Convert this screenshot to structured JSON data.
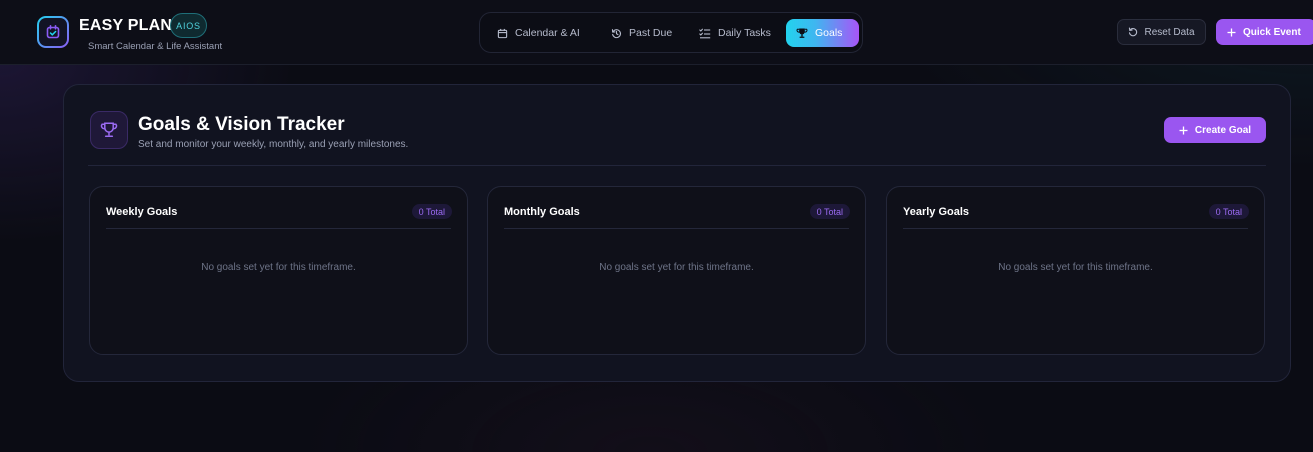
{
  "header": {
    "title": "EASY PLAN",
    "badge": "AIOS",
    "subtitle": "Smart Calendar & Life Assistant",
    "logo_icon": "calendar-check-icon"
  },
  "nav": {
    "tabs": [
      {
        "label": "Calendar & AI",
        "icon": "calendar-icon",
        "active": false
      },
      {
        "label": "Past Due",
        "icon": "history-icon",
        "active": false
      },
      {
        "label": "Daily Tasks",
        "icon": "list-checks-icon",
        "active": false
      },
      {
        "label": "Goals",
        "icon": "trophy-icon",
        "active": true
      }
    ]
  },
  "actions": {
    "reset_label": "Reset Data",
    "quick_event_label": "Quick Event"
  },
  "goals": {
    "title": "Goals & Vision Tracker",
    "subtitle": "Set and monitor your weekly, monthly, and yearly milestones.",
    "create_label": "Create Goal",
    "columns": [
      {
        "title": "Weekly Goals",
        "count": "0 Total",
        "empty_text": "No goals set yet for this timeframe."
      },
      {
        "title": "Monthly Goals",
        "count": "0 Total",
        "empty_text": "No goals set yet for this timeframe."
      },
      {
        "title": "Yearly Goals",
        "count": "0 Total",
        "empty_text": "No goals set yet for this timeframe."
      }
    ]
  },
  "colors": {
    "accent_purple": "#9a56f0",
    "accent_cyan": "#22d3ee",
    "background": "#0b0c14",
    "panel": "#111320"
  }
}
